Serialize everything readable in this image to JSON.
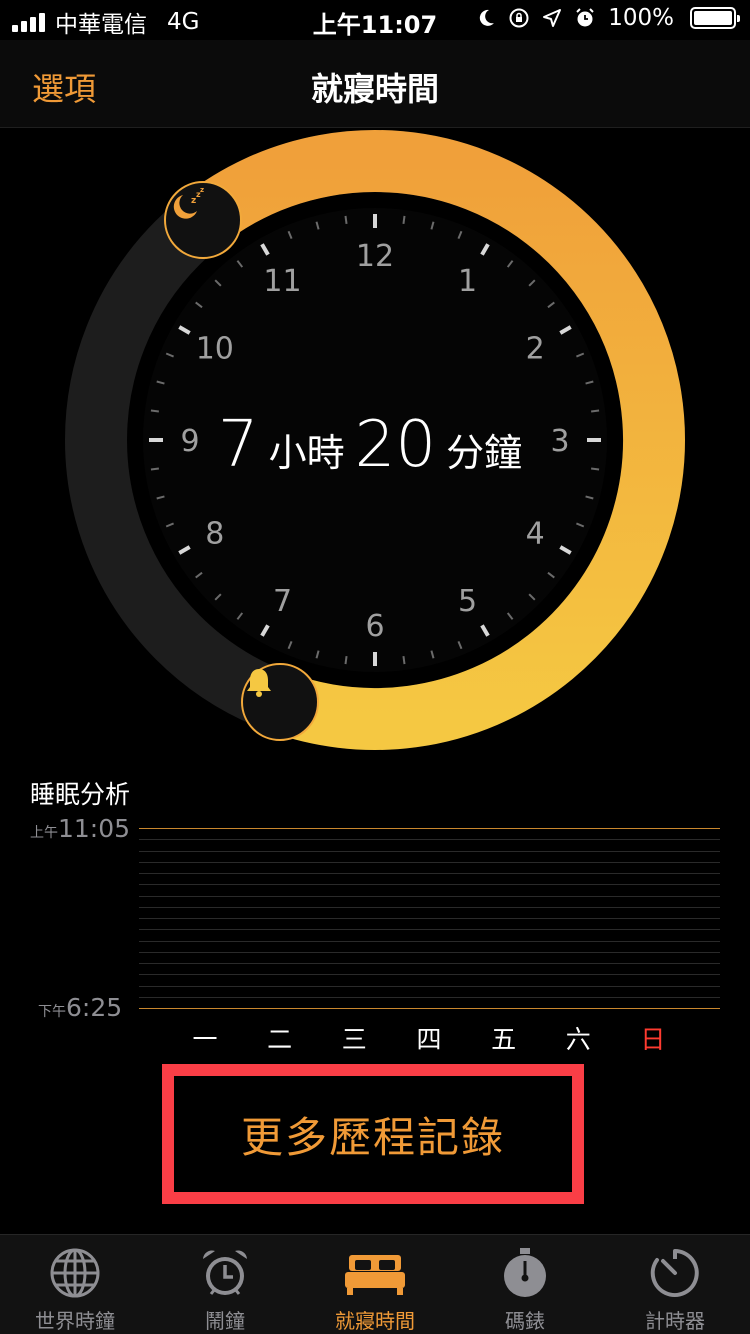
{
  "status_bar": {
    "carrier": "中華電信",
    "network": "4G",
    "time": "上午11:07",
    "battery": "100%",
    "icons": [
      "moon-icon",
      "orientation-lock-icon",
      "location-icon",
      "alarm-icon",
      "battery-icon"
    ]
  },
  "nav": {
    "left_label": "選項",
    "title": "就寢時間"
  },
  "clock": {
    "hours_value": "7",
    "hours_unit": "小時",
    "minutes_value": "20",
    "minutes_unit": "分鐘",
    "numbers": [
      "12",
      "1",
      "2",
      "3",
      "4",
      "5",
      "6",
      "7",
      "8",
      "9",
      "10",
      "11"
    ],
    "bedtime_icon": "moon-zzz-icon",
    "wake_icon": "bell-icon"
  },
  "sleep_analysis": {
    "title": "睡眠分析",
    "top_label_prefix": "上午",
    "top_label_time": "11:05",
    "bottom_label_prefix": "下午",
    "bottom_label_time": "6:25",
    "days": [
      "一",
      "二",
      "三",
      "四",
      "五",
      "六",
      "日"
    ]
  },
  "history_button": {
    "label": "更多歷程記錄"
  },
  "tabs": [
    {
      "label": "世界時鐘",
      "icon": "globe-icon",
      "active": false
    },
    {
      "label": "鬧鐘",
      "icon": "alarm-clock-icon",
      "active": false
    },
    {
      "label": "就寢時間",
      "icon": "bed-icon",
      "active": true
    },
    {
      "label": "碼錶",
      "icon": "stopwatch-icon",
      "active": false
    },
    {
      "label": "計時器",
      "icon": "timer-icon",
      "active": false
    }
  ],
  "colors": {
    "accent": "#f09a37",
    "ring_start": "#f0a03a",
    "ring_end": "#f5c842",
    "highlight_box": "#fa3e46",
    "sunday": "#ff3b30"
  }
}
